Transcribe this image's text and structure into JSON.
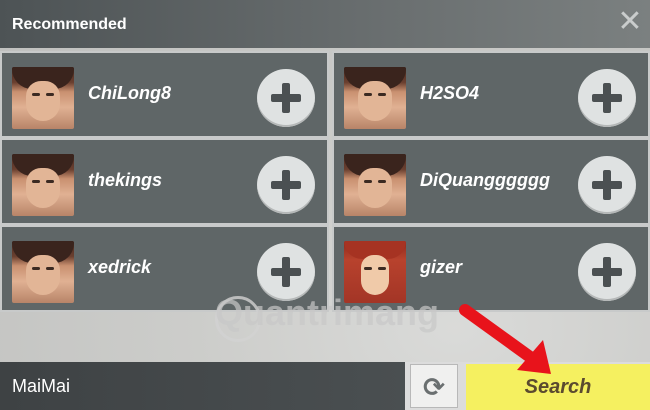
{
  "header": {
    "title": "Recommended",
    "close_icon": "close-icon"
  },
  "players": [
    {
      "name": "ChiLong8",
      "avatar": "male"
    },
    {
      "name": "H2SO4",
      "avatar": "male"
    },
    {
      "name": "thekings",
      "avatar": "male"
    },
    {
      "name": "DiQuangggggg",
      "avatar": "male"
    },
    {
      "name": "xedrick",
      "avatar": "male"
    },
    {
      "name": "gizer",
      "avatar": "female-red-hair"
    }
  ],
  "add_icon": "plus-icon",
  "watermark": "Quantrimang",
  "footer": {
    "input_value": "MaiMai",
    "refresh_icon": "refresh-icon",
    "search_label": "Search"
  },
  "colors": {
    "card": "#5f6667",
    "search": "#f5f060",
    "annotation_arrow": "#e8131b"
  }
}
